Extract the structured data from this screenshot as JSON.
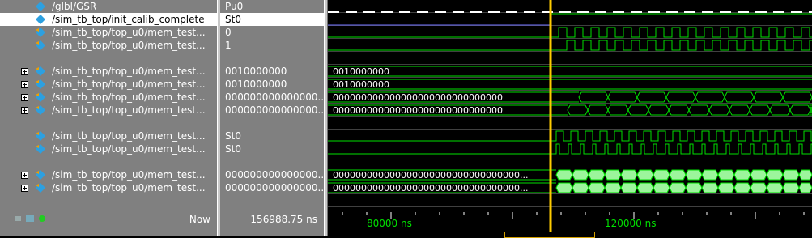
{
  "signals": [
    {
      "name": "/glbl/GSR",
      "value": "Pu0",
      "expandable": false,
      "icon": "signal-icon"
    },
    {
      "name": "/sim_tb_top/init_calib_complete",
      "value": "St0",
      "expandable": false,
      "icon": "signal-icon",
      "selected": true
    },
    {
      "name": "/sim_tb_top/top_u0/mem_test...",
      "value": "0",
      "expandable": false,
      "icon": "signal-icon"
    },
    {
      "name": "/sim_tb_top/top_u0/mem_test...",
      "value": "1",
      "expandable": false,
      "icon": "signal-icon"
    },
    {
      "name": "/sim_tb_top/top_u0/mem_test...",
      "value": "0010000000",
      "expandable": true,
      "icon": "signal-icon"
    },
    {
      "name": "/sim_tb_top/top_u0/mem_test...",
      "value": "0010000000",
      "expandable": true,
      "icon": "signal-icon"
    },
    {
      "name": "/sim_tb_top/top_u0/mem_test...",
      "value": "000000000000000...",
      "expandable": true,
      "icon": "signal-icon"
    },
    {
      "name": "/sim_tb_top/top_u0/mem_test...",
      "value": "000000000000000...",
      "expandable": true,
      "icon": "signal-icon"
    },
    {
      "name": "/sim_tb_top/top_u0/mem_test...",
      "value": "St0",
      "expandable": false,
      "icon": "signal-icon"
    },
    {
      "name": "/sim_tb_top/top_u0/mem_test...",
      "value": "St0",
      "expandable": false,
      "icon": "signal-icon"
    },
    {
      "name": "/sim_tb_top/top_u0/mem_test...",
      "value": "000000000000000...",
      "expandable": true,
      "icon": "signal-icon"
    },
    {
      "name": "/sim_tb_top/top_u0/mem_test...",
      "value": "000000000000000...",
      "expandable": true,
      "icon": "signal-icon"
    }
  ],
  "bus_labels": [
    "0010000000",
    "0010000000",
    "000000000000000000000000000000",
    "000000000000000000000000000000",
    "000000000000000000000000000000000...",
    "000000000000000000000000000000000..."
  ],
  "footer": {
    "now_label": "Now",
    "now_value": "156988.75 ns",
    "time_labels": [
      "80000 ns",
      "120000 ns"
    ]
  },
  "colors": {
    "wave": "#00e000",
    "bus_fill": "#9cf59c",
    "cursor": "#ffcc00",
    "gsr": "#ffffff",
    "calib": "#7070ff"
  }
}
